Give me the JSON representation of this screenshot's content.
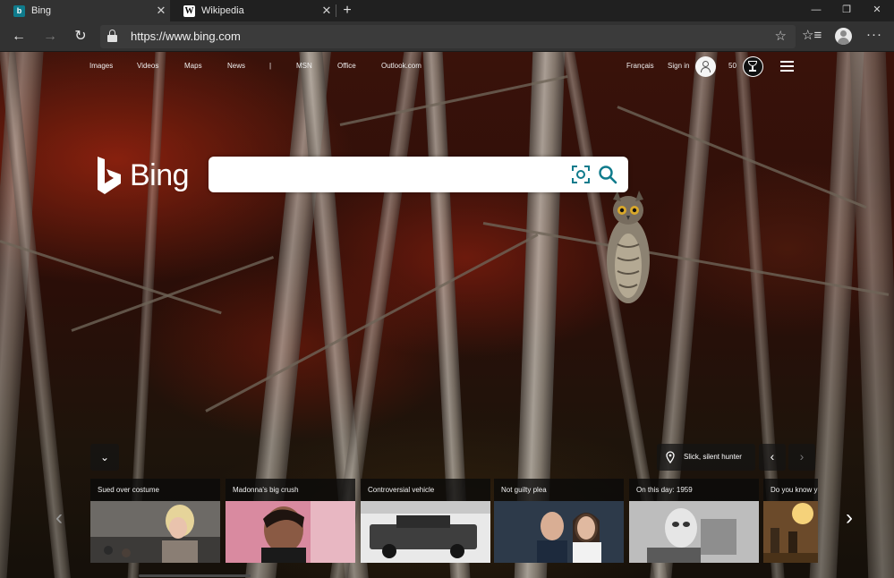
{
  "tabs": [
    {
      "title": "Bing",
      "icon": "bing-favicon",
      "active": true
    },
    {
      "title": "Wikipedia",
      "icon": "wikipedia-favicon",
      "active": false
    }
  ],
  "tab_icons": {
    "close": "✕",
    "new_tab": "+",
    "bing_glyph": "b",
    "wiki_glyph": "W"
  },
  "window_controls": {
    "minimize": "—",
    "restore": "❐",
    "close": "✕"
  },
  "toolbar": {
    "back": "←",
    "forward": "→",
    "refresh": "↻",
    "url": "https://www.bing.com",
    "favorite": "☆",
    "favorites_list": "☆≡",
    "more": "···"
  },
  "nav": {
    "links": [
      "Images",
      "Videos",
      "Maps",
      "News",
      "|",
      "MSN",
      "Office",
      "Outlook.com"
    ],
    "language": "Français",
    "sign_in": "Sign in",
    "rewards_points": "50"
  },
  "logo": {
    "text": "Bing"
  },
  "search": {
    "value": "",
    "placeholder": ""
  },
  "image_info": {
    "caption": "Slick, silent hunter",
    "prev": "‹",
    "next": "›"
  },
  "carousel": {
    "collapse": "⌄",
    "prev": "‹",
    "next": "›",
    "cards": [
      {
        "title": "Sued over costume"
      },
      {
        "title": "Madonna's big crush"
      },
      {
        "title": "Controversial vehicle"
      },
      {
        "title": "Not guilty plea"
      },
      {
        "title": "On this day: 1959"
      },
      {
        "title": "Do you know y"
      }
    ]
  },
  "colors": {
    "accent": "#0f7b8c",
    "page_bg": "#202020",
    "toolbar_bg": "#323232"
  }
}
